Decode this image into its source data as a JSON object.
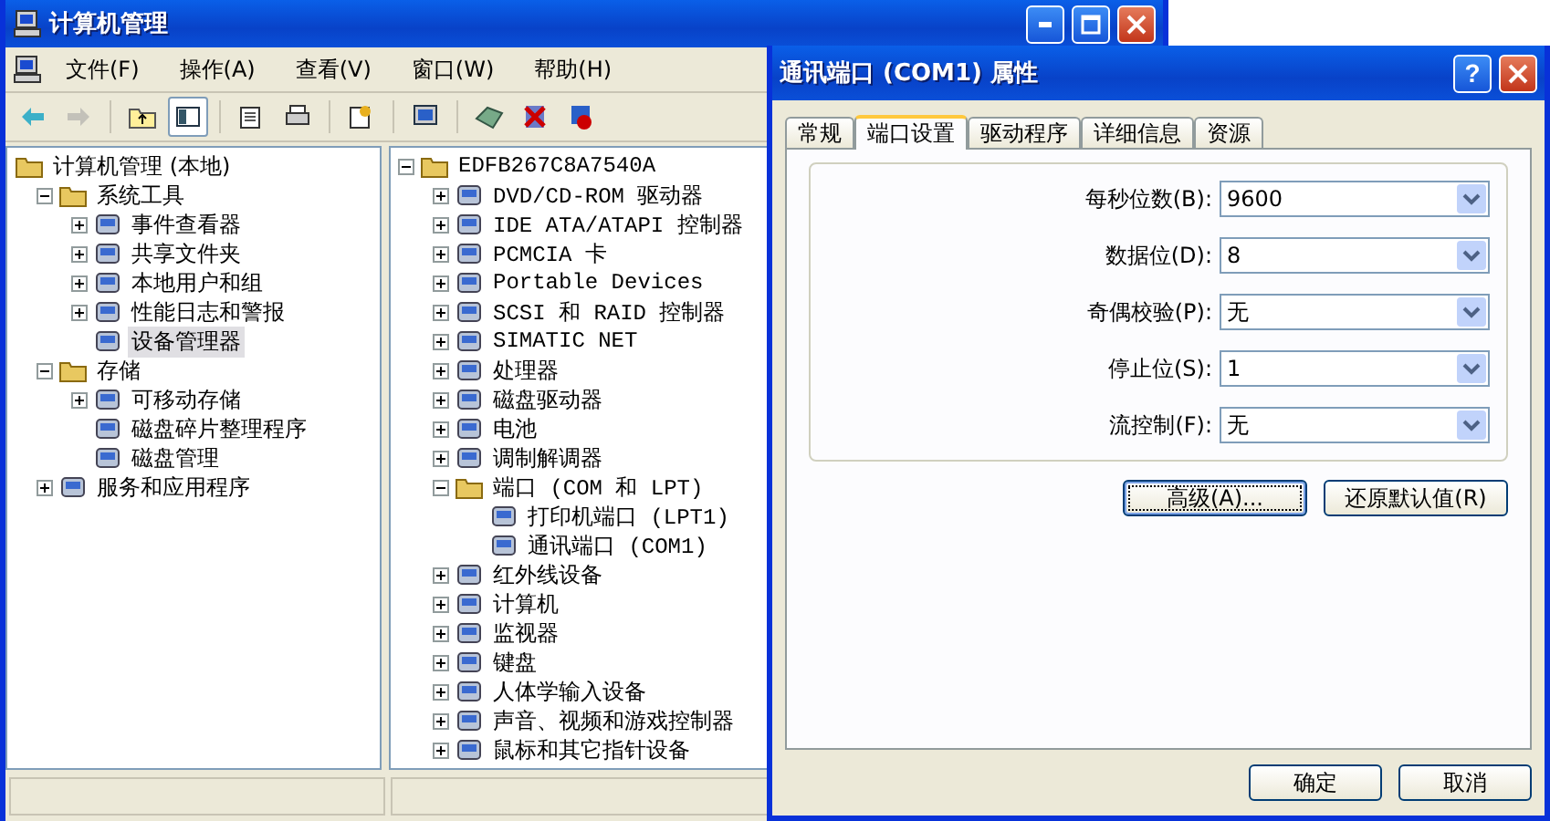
{
  "main_window": {
    "title": "计算机管理",
    "menu": [
      "文件(F)",
      "操作(A)",
      "查看(V)",
      "窗口(W)",
      "帮助(H)"
    ],
    "toolbar": [
      {
        "pressed": false,
        "disabled": false
      },
      {
        "pressed": false,
        "disabled": true
      },
      {
        "pressed": false,
        "disabled": false
      },
      {
        "pressed": true,
        "disabled": false
      },
      {
        "pressed": false,
        "disabled": false
      },
      {
        "pressed": false,
        "disabled": false
      },
      {
        "pressed": false,
        "disabled": false
      },
      {
        "pressed": false,
        "disabled": false
      },
      {
        "pressed": false,
        "disabled": false
      },
      {
        "pressed": false,
        "disabled": false
      },
      {
        "pressed": false,
        "disabled": false
      }
    ],
    "left_tree": [
      {
        "label": "计算机管理 (本地)",
        "selected": false,
        "children": [
          {
            "label": "系统工具",
            "expanded": true,
            "selected": false,
            "children": [
              {
                "label": "事件查看器",
                "expanded": false,
                "selected": false
              },
              {
                "label": "共享文件夹",
                "expanded": false,
                "selected": false
              },
              {
                "label": "本地用户和组",
                "expanded": false,
                "selected": false
              },
              {
                "label": "性能日志和警报",
                "expanded": false,
                "selected": false
              },
              {
                "label": "设备管理器",
                "selected": true
              }
            ]
          },
          {
            "label": "存储",
            "expanded": true,
            "selected": false,
            "children": [
              {
                "label": "可移动存储",
                "expanded": false,
                "selected": false
              },
              {
                "label": "磁盘碎片整理程序",
                "selected": false
              },
              {
                "label": "磁盘管理",
                "selected": false
              }
            ]
          },
          {
            "label": "服务和应用程序",
            "expanded": false,
            "selected": false
          }
        ]
      }
    ],
    "device_tree": [
      {
        "label": "EDFB267C8A7540A",
        "expanded": true,
        "selected": false,
        "children": [
          {
            "label": "DVD/CD-ROM 驱动器",
            "expanded": false,
            "selected": false
          },
          {
            "label": "IDE ATA/ATAPI 控制器",
            "expanded": false,
            "selected": false
          },
          {
            "label": "PCMCIA 卡",
            "expanded": false,
            "selected": false
          },
          {
            "label": "Portable Devices",
            "expanded": false,
            "selected": false
          },
          {
            "label": "SCSI 和 RAID 控制器",
            "expanded": false,
            "selected": false
          },
          {
            "label": "SIMATIC NET",
            "expanded": false,
            "selected": false
          },
          {
            "label": "处理器",
            "expanded": false,
            "selected": false
          },
          {
            "label": "磁盘驱动器",
            "expanded": false,
            "selected": false
          },
          {
            "label": "电池",
            "expanded": false,
            "selected": false
          },
          {
            "label": "调制解调器",
            "expanded": false,
            "selected": false
          },
          {
            "label": "端口 (COM 和 LPT)",
            "expanded": true,
            "selected": false,
            "children": [
              {
                "label": "打印机端口 (LPT1)",
                "selected": false
              },
              {
                "label": "通讯端口 (COM1)",
                "selected": false
              }
            ]
          },
          {
            "label": "红外线设备",
            "expanded": false,
            "selected": false
          },
          {
            "label": "计算机",
            "expanded": false,
            "selected": false
          },
          {
            "label": "监视器",
            "expanded": false,
            "selected": false
          },
          {
            "label": "键盘",
            "expanded": false,
            "selected": false
          },
          {
            "label": "人体学输入设备",
            "expanded": false,
            "selected": false
          },
          {
            "label": "声音、视频和游戏控制器",
            "expanded": false,
            "selected": false
          },
          {
            "label": "鼠标和其它指针设备",
            "expanded": false,
            "selected": false
          }
        ]
      }
    ]
  },
  "dialog": {
    "title": "通讯端口 (COM1) 属性",
    "help_label": "?",
    "tabs": [
      {
        "label": "常规",
        "selected": false
      },
      {
        "label": "端口设置",
        "selected": true
      },
      {
        "label": "驱动程序",
        "selected": false
      },
      {
        "label": "详细信息",
        "selected": false
      },
      {
        "label": "资源",
        "selected": false
      }
    ],
    "fields": [
      {
        "label": "每秒位数(B):",
        "value": "9600"
      },
      {
        "label": "数据位(D):",
        "value": "8"
      },
      {
        "label": "奇偶校验(P):",
        "value": "无"
      },
      {
        "label": "停止位(S):",
        "value": "1"
      },
      {
        "label": "流控制(F):",
        "value": "无"
      }
    ],
    "panel_buttons": [
      {
        "label": "高级(A)...",
        "focused": true
      },
      {
        "label": "还原默认值(R)",
        "focused": false
      }
    ],
    "buttons": [
      {
        "label": "确定",
        "focused": false
      },
      {
        "label": "取消",
        "focused": false
      }
    ]
  }
}
